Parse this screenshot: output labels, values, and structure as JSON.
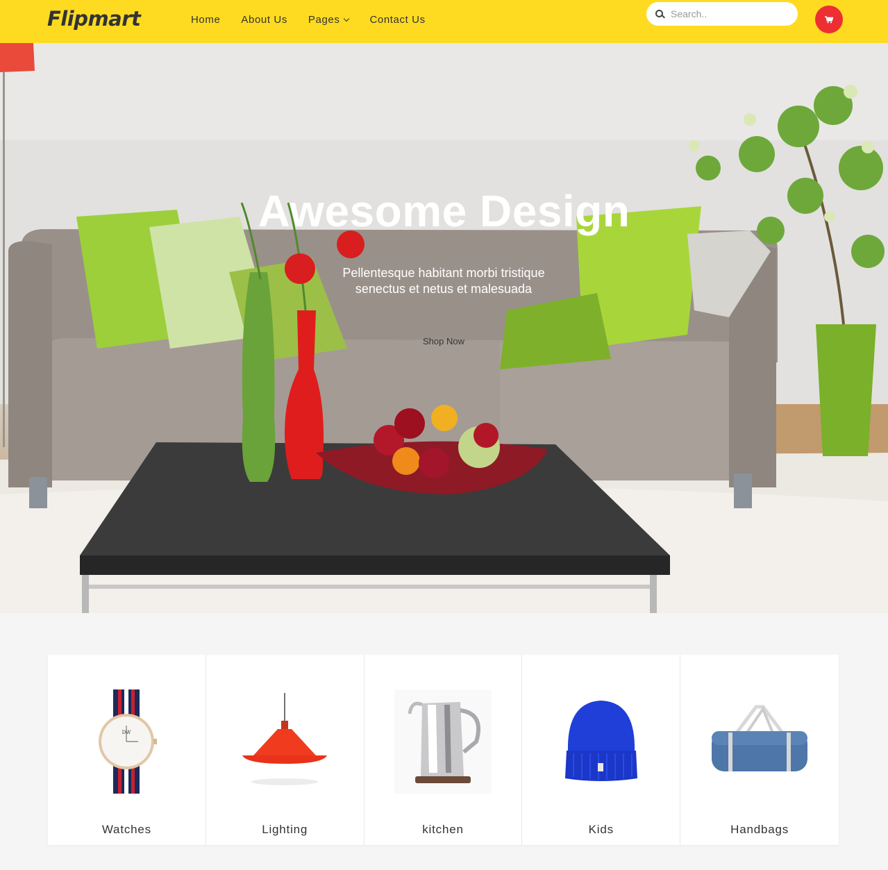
{
  "header": {
    "logo": "Flipmart",
    "nav": [
      {
        "label": "Home"
      },
      {
        "label": "About Us"
      },
      {
        "label": "Pages"
      },
      {
        "label": "Contact Us"
      }
    ],
    "search": {
      "placeholder": "Search.."
    },
    "colors": {
      "header_bg": "#fedb21",
      "cart_bg": "#ed2f34"
    }
  },
  "hero": {
    "title": "Awesome Design",
    "subtitle": "Pellentesque habitant morbi tristique senectus et netus et malesuada",
    "button": "Shop Now"
  },
  "categories": [
    {
      "label": "Watches",
      "icon": "watch-icon"
    },
    {
      "label": "Lighting",
      "icon": "lamp-icon"
    },
    {
      "label": "kitchen",
      "icon": "kettle-icon"
    },
    {
      "label": "Kids",
      "icon": "beanie-icon"
    },
    {
      "label": "Handbags",
      "icon": "duffel-bag-icon"
    }
  ]
}
